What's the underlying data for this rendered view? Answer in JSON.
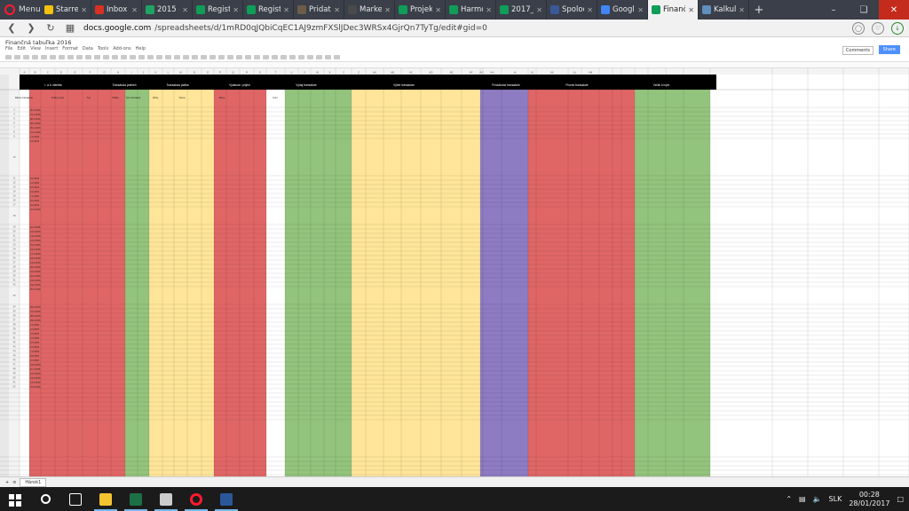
{
  "browser": {
    "menu_label": "Menu",
    "tabs": [
      {
        "title": "Starred",
        "icon": "starred-icon",
        "color": "#f4c20d",
        "active": false
      },
      {
        "title": "Inbox -",
        "icon": "gmail-icon",
        "color": "#d93025",
        "active": false
      },
      {
        "title": "2015 -",
        "icon": "drive-icon",
        "color": "#1fa463",
        "active": false
      },
      {
        "title": "Registr",
        "icon": "sheets-icon",
        "color": "#0f9d58",
        "active": false
      },
      {
        "title": "Registr",
        "icon": "sheets-icon",
        "color": "#0f9d58",
        "active": false
      },
      {
        "title": "Pridat",
        "icon": "page-icon",
        "color": "#6d5c4a",
        "active": false
      },
      {
        "title": "Market",
        "icon": "page-icon",
        "color": "#4a4a4a",
        "active": false
      },
      {
        "title": "Projekt",
        "icon": "sheets-icon",
        "color": "#0f9d58",
        "active": false
      },
      {
        "title": "Harmo",
        "icon": "sheets-icon",
        "color": "#0f9d58",
        "active": false
      },
      {
        "title": "2017_0",
        "icon": "sheets-icon",
        "color": "#0f9d58",
        "active": false
      },
      {
        "title": "Spoloc",
        "icon": "facebook-icon",
        "color": "#3b5998",
        "active": false
      },
      {
        "title": "Google",
        "icon": "calendar-icon",
        "color": "#4285f4",
        "active": false
      },
      {
        "title": "Finančn",
        "icon": "sheets-icon",
        "color": "#0f9d58",
        "active": true
      },
      {
        "title": "Kalkula",
        "icon": "calculator-icon",
        "color": "#5f8fbf",
        "active": false
      }
    ],
    "url_prefix": "docs.google.com",
    "url_path": "/spreadsheets/d/1mRD0qJQbiCqEC1AJ9zmFXSlJDec3WRSx4GjrQn7TyTg/edit#gid=0"
  },
  "sheets": {
    "doc_title": "Finančná tabuľka 2016",
    "menu": [
      "File",
      "Edit",
      "View",
      "Insert",
      "Format",
      "Data",
      "Tools",
      "Add-ons",
      "Help"
    ],
    "comments_label": "Comments",
    "share_label": "Share",
    "tabs": [
      "+",
      "≡",
      "Hárok1"
    ],
    "col_headers": [
      "A",
      "B",
      "C",
      "D",
      "E",
      "F",
      "G",
      "H",
      "I",
      "J",
      "K",
      "L",
      "M",
      "N",
      "O",
      "P",
      "Q",
      "R",
      "S",
      "T",
      "U",
      "V",
      "W",
      "X",
      "Y",
      "Z",
      "AA",
      "AB",
      "AC",
      "AD",
      "AE",
      "AF",
      "AG",
      "AH",
      "AI",
      "AJ",
      "AK",
      "AL",
      "AM"
    ],
    "sections": [
      {
        "label": "I. a II. identita",
        "color": "#e06666"
      },
      {
        "label": "Transakcia priebeh",
        "color": "#93c47d"
      },
      {
        "label": "Transakcia platba",
        "color": "#ffe599"
      },
      {
        "label": "Výdavok / príjem",
        "color": "#e06666"
      },
      {
        "label": "Výdaj transakcie",
        "color": "#93c47d"
      },
      {
        "label": "Výber transakcie",
        "color": "#ffe599"
      },
      {
        "label": "Príslušnosť transakcie",
        "color": "#8e7cc3"
      },
      {
        "label": "Proces transakcie",
        "color": "#e06666"
      },
      {
        "label": "Vzťah k iným",
        "color": "#93c47d"
      }
    ],
    "header_cells": [
      "Dátum transakcie",
      "Krátky popis",
      "Typ",
      "Platba",
      "Typ transakcie",
      "Zdroj",
      "Suma",
      "Mena",
      "Kurz"
    ],
    "row_dates": [
      "30.1.2016",
      "31.1.2016",
      "28.1.2016",
      "29.1.2016",
      "30.1.2016",
      "31.1.2016",
      "1.2.2016",
      "2.2.2016",
      "3.2.2016",
      "4.2.2016",
      "5.2.2016",
      "6.2.2016",
      "7.2.2016",
      "8.2.2016",
      "9.2.2016",
      "10.2.2016",
      "11.2.2016",
      "12.2.2016",
      "13.2.2016",
      "14.2.2016",
      "15.2.2016",
      "16.2.2016",
      "17.2.2016",
      "18.2.2016",
      "19.2.2016",
      "20.2.2016",
      "21.2.2016",
      "22.2.2016",
      "23.2.2016",
      "24.2.2016",
      "25.2.2016",
      "26.2.2016",
      "27.2.2016",
      "28.2.2016",
      "29.2.2016",
      "1.3.2016",
      "2.3.2016",
      "3.3.2016",
      "4.3.2016",
      "5.3.2016",
      "6.3.2016",
      "7.3.2016",
      "8.3.2016",
      "9.3.2016",
      "10.3.2016",
      "11.3.2016",
      "12.3.2016",
      "13.3.2016",
      "14.3.2016",
      "15.3.2016"
    ]
  },
  "taskbar": {
    "apps": [
      {
        "name": "start-button",
        "color": "#ffffff"
      },
      {
        "name": "search-icon",
        "color": "#ffffff"
      },
      {
        "name": "task-view-icon",
        "color": "#ffffff"
      },
      {
        "name": "explorer-icon",
        "color": "#f4c430"
      },
      {
        "name": "excel-icon",
        "color": "#1d7044"
      },
      {
        "name": "settings-icon",
        "color": "#cccccc"
      },
      {
        "name": "opera-icon",
        "color": "#ff1b2d"
      },
      {
        "name": "word-icon",
        "color": "#2b579a"
      }
    ],
    "language": "SLK",
    "time": "00:28",
    "date": "28/01/2017"
  }
}
